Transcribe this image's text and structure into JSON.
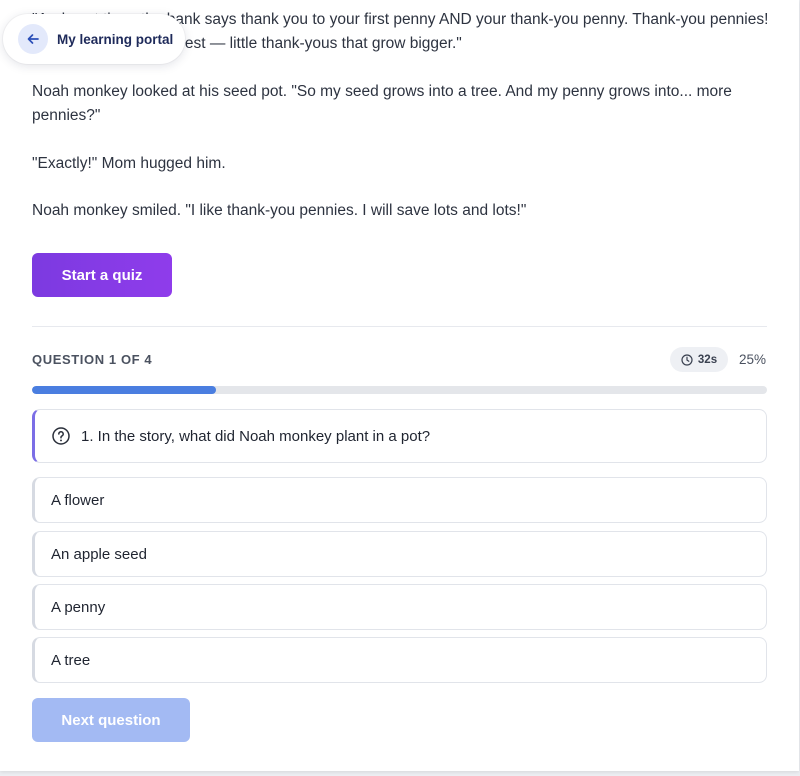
{
  "back": {
    "label": "My learning portal",
    "icon": "arrow-left-icon"
  },
  "story": {
    "paragraphs": [
      "\"And next time, the bank says thank you to your first penny AND your thank-you penny. Thank-you pennies! That's compound interest — little thank-yous that grow bigger.\"",
      "Noah monkey looked at his seed pot. \"So my seed grows into a tree. And my penny grows into... more pennies?\"",
      "\"Exactly!\" Mom hugged him.",
      "Noah monkey smiled. \"I like thank-you pennies. I will save lots and lots!\""
    ]
  },
  "quiz_button": {
    "label": "Start a quiz"
  },
  "quiz": {
    "counter": "QUESTION 1 OF 4",
    "timer": "32s",
    "percent": "25%",
    "progress_fraction": 0.25,
    "question": "1. In the story, what did Noah monkey plant in a pot?",
    "options": [
      "A flower",
      "An apple seed",
      "A penny",
      "A tree"
    ],
    "next_label": "Next question"
  },
  "colors": {
    "accent_purple": "#8b3ae8",
    "progress_blue": "#4a7ee0",
    "next_disabled": "#a3baf3"
  }
}
